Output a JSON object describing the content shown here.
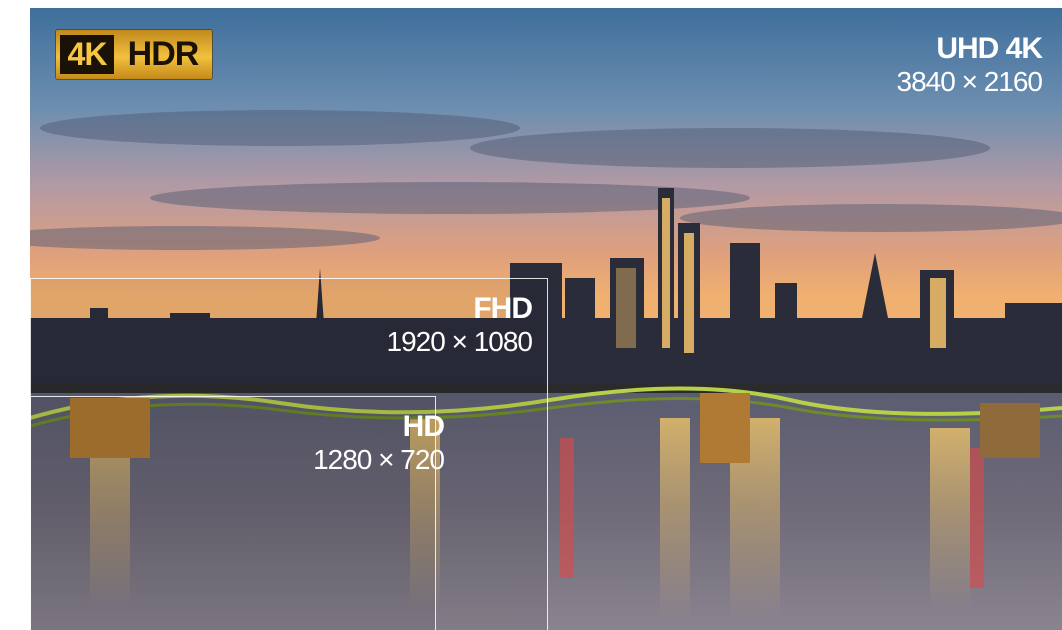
{
  "badge": {
    "part1": "4K",
    "part2": "HDR"
  },
  "tiers": {
    "uhd": {
      "name": "UHD 4K",
      "resolution": "3840 × 2160"
    },
    "fhd": {
      "name": "FHD",
      "resolution": "1920 × 1080"
    },
    "hd": {
      "name": "HD",
      "resolution": "1280 × 720"
    }
  },
  "colors": {
    "badge_gold": "#f2c03e",
    "badge_dark": "#1a1206",
    "label_text": "#ffffff"
  }
}
